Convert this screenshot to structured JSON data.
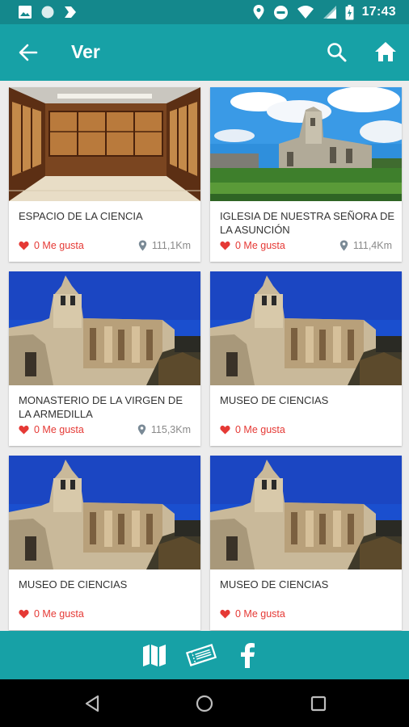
{
  "status_bar": {
    "time": "17:43"
  },
  "app_bar": {
    "title": "Ver"
  },
  "places": [
    {
      "name": "ESPACIO DE LA CIENCIA",
      "likes": "0 Me gusta",
      "distance": "111,1Km",
      "image": "museum-interior-photo"
    },
    {
      "name": "IGLESIA DE NUESTRA SEÑORA DE LA ASUNCIÓN",
      "likes": "0 Me gusta",
      "distance": "111,4Km",
      "image": "ruined-church-field-photo"
    },
    {
      "name": "MONASTERIO DE LA VIRGEN DE LA ARMEDILLA",
      "likes": "0 Me gusta",
      "distance": "115,3Km",
      "image": "monastery-ruins-photo"
    },
    {
      "name": "MUSEO DE CIENCIAS",
      "likes": "0 Me gusta",
      "distance": "",
      "image": "monastery-ruins-photo"
    },
    {
      "name": "MUSEO DE CIENCIAS",
      "likes": "0 Me gusta",
      "distance": "",
      "image": "monastery-ruins-photo"
    },
    {
      "name": "MUSEO DE CIENCIAS",
      "likes": "0 Me gusta",
      "distance": "",
      "image": "monastery-ruins-photo"
    }
  ],
  "bottom_bar": {
    "icons": [
      "map-icon",
      "ticket-icon",
      "facebook-icon"
    ]
  },
  "colors": {
    "primary": "#17a1a6",
    "primary_dark": "#14888c",
    "like": "#e53935",
    "text": "#333333",
    "muted": "#8a8a8a"
  }
}
